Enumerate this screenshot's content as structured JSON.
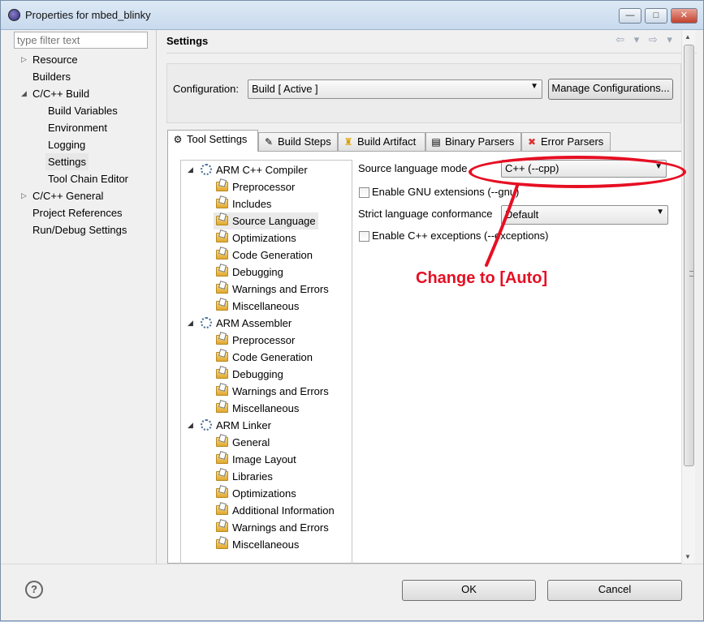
{
  "window": {
    "title": "Properties for mbed_blinky",
    "min_label": "—",
    "max_label": "□",
    "close_label": "✕"
  },
  "filter": {
    "placeholder": "type filter text"
  },
  "nav": {
    "items": [
      {
        "label": "Resource",
        "expander": "▷"
      },
      {
        "label": "Builders"
      },
      {
        "label": "C/C++ Build",
        "expander": "◢"
      },
      {
        "label": "Build Variables"
      },
      {
        "label": "Environment"
      },
      {
        "label": "Logging"
      },
      {
        "label": "Settings"
      },
      {
        "label": "Tool Chain Editor"
      },
      {
        "label": "C/C++ General",
        "expander": "▷"
      },
      {
        "label": "Project References"
      },
      {
        "label": "Run/Debug Settings"
      }
    ]
  },
  "header": {
    "title": "Settings",
    "arrows": "⇦ ▾ ⇨ ▾ ▾"
  },
  "configuration": {
    "label": "Configuration:",
    "value": "Build  [ Active ]",
    "manage_label": "Manage Configurations..."
  },
  "tabs": [
    {
      "label": "Tool Settings",
      "icon": "⚙"
    },
    {
      "label": "Build Steps",
      "icon": "✎"
    },
    {
      "label": "Build Artifact",
      "icon": "♜"
    },
    {
      "label": "Binary Parsers",
      "icon": "▤"
    },
    {
      "label": "Error Parsers",
      "icon": "✖"
    }
  ],
  "tree": {
    "compiler": {
      "label": "ARM C++ Compiler",
      "children": [
        "Preprocessor",
        "Includes",
        "Source Language",
        "Optimizations",
        "Code Generation",
        "Debugging",
        "Warnings and Errors",
        "Miscellaneous"
      ]
    },
    "assembler": {
      "label": "ARM Assembler",
      "children": [
        "Preprocessor",
        "Code Generation",
        "Debugging",
        "Warnings and Errors",
        "Miscellaneous"
      ]
    },
    "linker": {
      "label": "ARM Linker",
      "children": [
        "General",
        "Image Layout",
        "Libraries",
        "Optimizations",
        "Additional Information",
        "Warnings and Errors",
        "Miscellaneous"
      ]
    },
    "expander": "◢"
  },
  "options": {
    "source_mode_label": "Source language mode",
    "source_mode_value": "C++ (--cpp)",
    "gnu_label": "Enable GNU extensions (--gnu)",
    "strict_label": "Strict language conformance",
    "strict_value": "Default",
    "exceptions_label": "Enable C++ exceptions (--exceptions)"
  },
  "annotation": {
    "text": "Change to [Auto]",
    "color": "#e60f23"
  },
  "footer": {
    "help": "?",
    "ok_label": "OK",
    "cancel_label": "Cancel"
  }
}
